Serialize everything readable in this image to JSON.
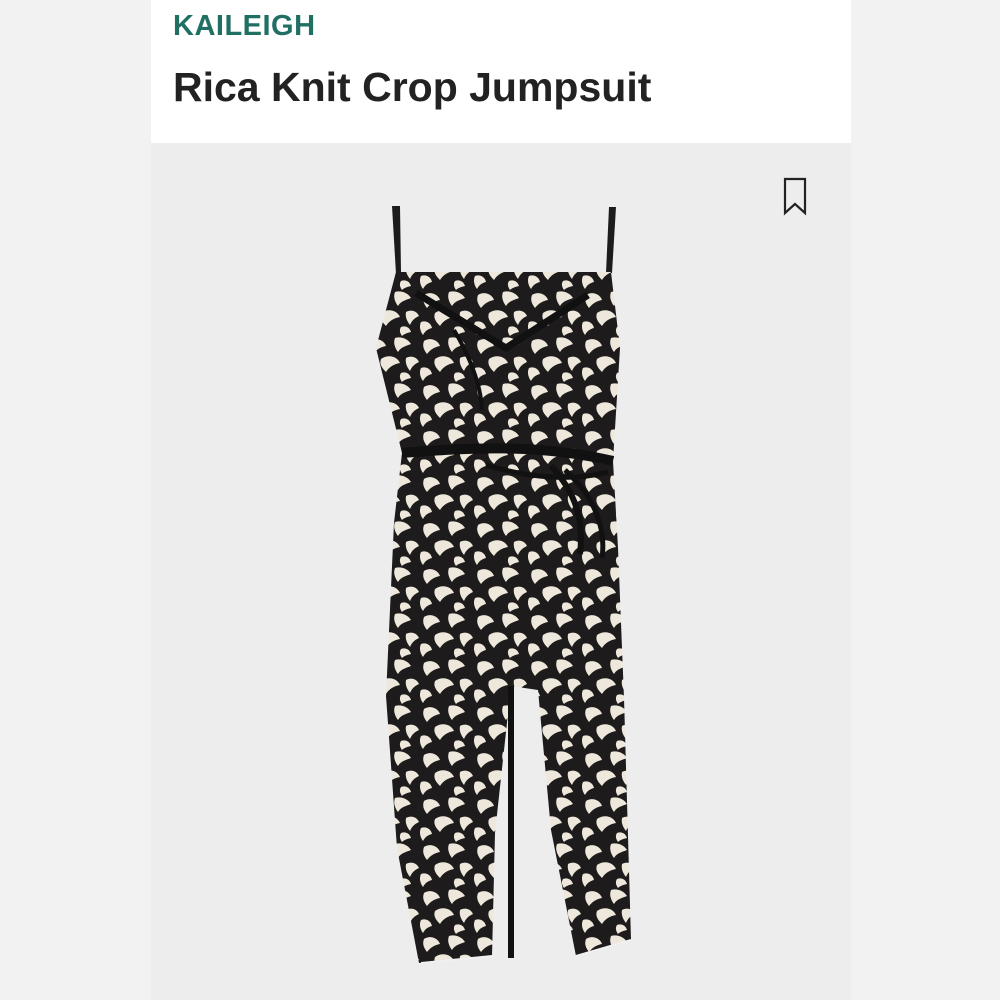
{
  "product": {
    "brand": "KAILEIGH",
    "name": "Rica Knit Crop Jumpsuit"
  },
  "actions": {
    "save_icon": "bookmark-icon"
  },
  "colors": {
    "brand": "#1f6f63",
    "title": "#222222",
    "header_bg": "#ffffff",
    "image_bg": "#ededee",
    "garment_dark": "#1d1b1b",
    "garment_light": "#eee8dc"
  }
}
